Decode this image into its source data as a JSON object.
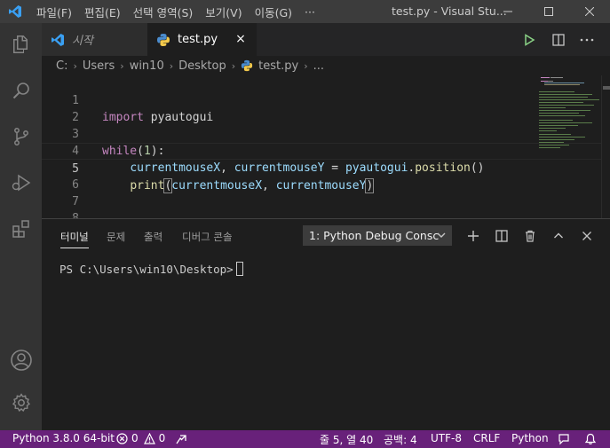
{
  "titlebar": {
    "menu": [
      "파일(F)",
      "편집(E)",
      "선택 영역(S)",
      "보기(V)",
      "이동(G)",
      "···"
    ],
    "title": "test.py - Visual Stu..."
  },
  "tabs": [
    {
      "label": "시작",
      "icon": "vscode-logo-icon"
    },
    {
      "label": "test.py",
      "icon": "python-icon",
      "close": "×"
    }
  ],
  "breadcrumb": [
    "C:",
    "Users",
    "win10",
    "Desktop",
    "test.py",
    "..."
  ],
  "editor": {
    "lines": [
      {
        "num": "1"
      },
      {
        "num": "2"
      },
      {
        "num": "3"
      },
      {
        "num": "4"
      },
      {
        "num": "5"
      },
      {
        "num": "6"
      },
      {
        "num": "7"
      },
      {
        "num": "8"
      }
    ],
    "code": {
      "l1_kw": "import",
      "l1_mod": " pyautogui",
      "l3_kw": "while",
      "l3_open": "(",
      "l3_num": "1",
      "l3_close": "):",
      "l4_indent": "    ",
      "l4_a": "currentmouseX",
      "l4_comma": ", ",
      "l4_b": "currentmouseY",
      "l4_eq": " = ",
      "l4_mod": "pyautogui",
      "l4_dot": ".",
      "l4_fn": "position",
      "l4_paren": "()",
      "l5_indent": "    ",
      "l5_fn": "print",
      "l5_open": "(",
      "l5_a": "currentmouseX",
      "l5_comma": ", ",
      "l5_b": "currentmouseY",
      "l5_close": ")"
    }
  },
  "panel": {
    "tabs": [
      "터미널",
      "문제",
      "출력",
      "디버그 콘솔"
    ],
    "selected_terminal": "1: Python Debug Consc",
    "prompt": "PS C:\\Users\\win10\\Desktop>"
  },
  "statusbar": {
    "python": "Python 3.8.0 64-bit",
    "errors": "0",
    "warnings": "0",
    "position": "줄 5, 열 40",
    "spaces": "공백: 4",
    "encoding": "UTF-8",
    "eol": "CRLF",
    "language": "Python"
  },
  "colors": {
    "statusbar": "#68217a",
    "titlebar": "#3c3c3c",
    "activitybar": "#333333",
    "editor_bg": "#1e1e1e",
    "keyword": "#c586c0",
    "function": "#dcdcaa",
    "number": "#b5cea8",
    "variable": "#9cdcfe"
  }
}
